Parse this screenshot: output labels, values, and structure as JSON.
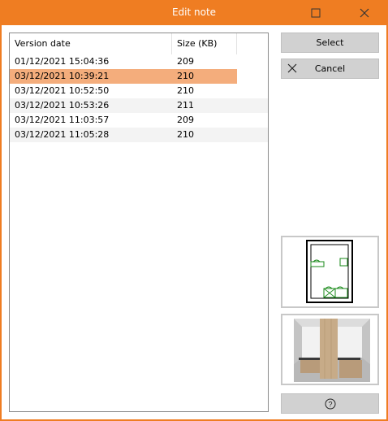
{
  "window": {
    "title": "Edit note",
    "accent_color": "#ef7d22"
  },
  "list": {
    "columns": [
      "Version date",
      "Size (KB)"
    ],
    "rows": [
      {
        "date": "01/12/2021 15:04:36",
        "size": "209"
      },
      {
        "date": "03/12/2021 10:39:21",
        "size": "210"
      },
      {
        "date": "03/12/2021 10:52:50",
        "size": "210"
      },
      {
        "date": "03/12/2021 10:53:26",
        "size": "211"
      },
      {
        "date": "03/12/2021 11:03:57",
        "size": "209"
      },
      {
        "date": "03/12/2021 11:05:28",
        "size": "210"
      }
    ],
    "selected_index": 1,
    "selection_color": "#f4ad7c"
  },
  "buttons": {
    "select_label": "Select",
    "cancel_label": "Cancel",
    "help_icon": "question-circle-icon"
  },
  "previews": {
    "plan": "floor-plan-thumbnail",
    "render": "3d-kitchen-thumbnail"
  }
}
